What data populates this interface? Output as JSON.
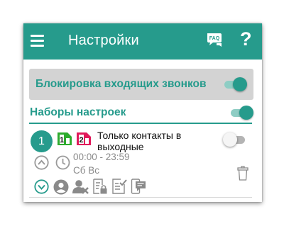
{
  "appbar": {
    "title": "Настройки",
    "faq_label": "FAQ",
    "help_label": "?",
    "color": "#269b8c"
  },
  "block_incoming": {
    "label": "Блокировка входящих звонков",
    "enabled": true
  },
  "profiles": {
    "title": "Наборы настроек",
    "enabled": true,
    "items": [
      {
        "number": "1",
        "sim1_label": "1",
        "sim2_label": "2",
        "name": "Только контакты в выходные",
        "enabled": false,
        "time": "00:00 - 23:59",
        "days": "Сб Вс"
      }
    ]
  },
  "icons": {
    "sim1_color": "#2eab2e",
    "sim2_color": "#e0195a",
    "accent": "#269b8c"
  }
}
